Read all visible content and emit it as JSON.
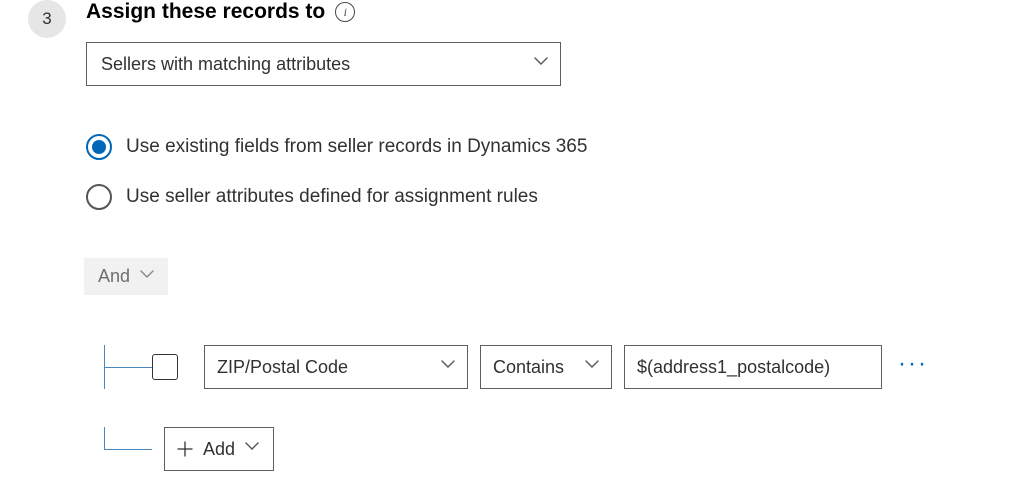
{
  "step": {
    "number": "3",
    "title": "Assign these records to"
  },
  "assignTo": {
    "selected": "Sellers with matching attributes"
  },
  "radios": {
    "existing": "Use existing fields from seller records in Dynamics 365",
    "defined": "Use seller attributes defined for assignment rules"
  },
  "builder": {
    "logic": "And",
    "rows": [
      {
        "field": "ZIP/Postal Code",
        "operator": "Contains",
        "value": "$(address1_postalcode)"
      }
    ],
    "addLabel": "Add"
  }
}
